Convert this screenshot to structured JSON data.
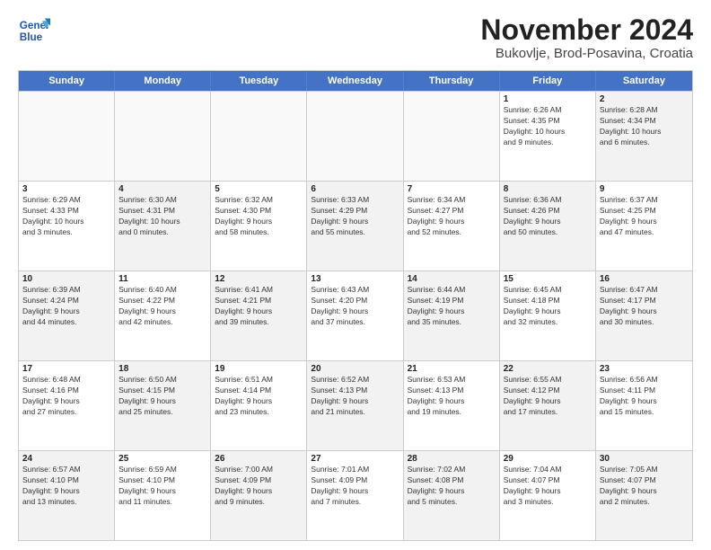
{
  "header": {
    "title": "November 2024",
    "subtitle": "Bukovlje, Brod-Posavina, Croatia",
    "logo_line1": "General",
    "logo_line2": "Blue"
  },
  "days_of_week": [
    "Sunday",
    "Monday",
    "Tuesday",
    "Wednesday",
    "Thursday",
    "Friday",
    "Saturday"
  ],
  "rows": [
    [
      {
        "day": "",
        "info": "",
        "empty": true
      },
      {
        "day": "",
        "info": "",
        "empty": true
      },
      {
        "day": "",
        "info": "",
        "empty": true
      },
      {
        "day": "",
        "info": "",
        "empty": true
      },
      {
        "day": "",
        "info": "",
        "empty": true
      },
      {
        "day": "1",
        "info": "Sunrise: 6:26 AM\nSunset: 4:35 PM\nDaylight: 10 hours\nand 9 minutes.",
        "empty": false
      },
      {
        "day": "2",
        "info": "Sunrise: 6:28 AM\nSunset: 4:34 PM\nDaylight: 10 hours\nand 6 minutes.",
        "empty": false,
        "shaded": true
      }
    ],
    [
      {
        "day": "3",
        "info": "Sunrise: 6:29 AM\nSunset: 4:33 PM\nDaylight: 10 hours\nand 3 minutes.",
        "empty": false
      },
      {
        "day": "4",
        "info": "Sunrise: 6:30 AM\nSunset: 4:31 PM\nDaylight: 10 hours\nand 0 minutes.",
        "empty": false,
        "shaded": true
      },
      {
        "day": "5",
        "info": "Sunrise: 6:32 AM\nSunset: 4:30 PM\nDaylight: 9 hours\nand 58 minutes.",
        "empty": false
      },
      {
        "day": "6",
        "info": "Sunrise: 6:33 AM\nSunset: 4:29 PM\nDaylight: 9 hours\nand 55 minutes.",
        "empty": false,
        "shaded": true
      },
      {
        "day": "7",
        "info": "Sunrise: 6:34 AM\nSunset: 4:27 PM\nDaylight: 9 hours\nand 52 minutes.",
        "empty": false
      },
      {
        "day": "8",
        "info": "Sunrise: 6:36 AM\nSunset: 4:26 PM\nDaylight: 9 hours\nand 50 minutes.",
        "empty": false,
        "shaded": true
      },
      {
        "day": "9",
        "info": "Sunrise: 6:37 AM\nSunset: 4:25 PM\nDaylight: 9 hours\nand 47 minutes.",
        "empty": false
      }
    ],
    [
      {
        "day": "10",
        "info": "Sunrise: 6:39 AM\nSunset: 4:24 PM\nDaylight: 9 hours\nand 44 minutes.",
        "empty": false,
        "shaded": true
      },
      {
        "day": "11",
        "info": "Sunrise: 6:40 AM\nSunset: 4:22 PM\nDaylight: 9 hours\nand 42 minutes.",
        "empty": false
      },
      {
        "day": "12",
        "info": "Sunrise: 6:41 AM\nSunset: 4:21 PM\nDaylight: 9 hours\nand 39 minutes.",
        "empty": false,
        "shaded": true
      },
      {
        "day": "13",
        "info": "Sunrise: 6:43 AM\nSunset: 4:20 PM\nDaylight: 9 hours\nand 37 minutes.",
        "empty": false
      },
      {
        "day": "14",
        "info": "Sunrise: 6:44 AM\nSunset: 4:19 PM\nDaylight: 9 hours\nand 35 minutes.",
        "empty": false,
        "shaded": true
      },
      {
        "day": "15",
        "info": "Sunrise: 6:45 AM\nSunset: 4:18 PM\nDaylight: 9 hours\nand 32 minutes.",
        "empty": false
      },
      {
        "day": "16",
        "info": "Sunrise: 6:47 AM\nSunset: 4:17 PM\nDaylight: 9 hours\nand 30 minutes.",
        "empty": false,
        "shaded": true
      }
    ],
    [
      {
        "day": "17",
        "info": "Sunrise: 6:48 AM\nSunset: 4:16 PM\nDaylight: 9 hours\nand 27 minutes.",
        "empty": false
      },
      {
        "day": "18",
        "info": "Sunrise: 6:50 AM\nSunset: 4:15 PM\nDaylight: 9 hours\nand 25 minutes.",
        "empty": false,
        "shaded": true
      },
      {
        "day": "19",
        "info": "Sunrise: 6:51 AM\nSunset: 4:14 PM\nDaylight: 9 hours\nand 23 minutes.",
        "empty": false
      },
      {
        "day": "20",
        "info": "Sunrise: 6:52 AM\nSunset: 4:13 PM\nDaylight: 9 hours\nand 21 minutes.",
        "empty": false,
        "shaded": true
      },
      {
        "day": "21",
        "info": "Sunrise: 6:53 AM\nSunset: 4:13 PM\nDaylight: 9 hours\nand 19 minutes.",
        "empty": false
      },
      {
        "day": "22",
        "info": "Sunrise: 6:55 AM\nSunset: 4:12 PM\nDaylight: 9 hours\nand 17 minutes.",
        "empty": false,
        "shaded": true
      },
      {
        "day": "23",
        "info": "Sunrise: 6:56 AM\nSunset: 4:11 PM\nDaylight: 9 hours\nand 15 minutes.",
        "empty": false
      }
    ],
    [
      {
        "day": "24",
        "info": "Sunrise: 6:57 AM\nSunset: 4:10 PM\nDaylight: 9 hours\nand 13 minutes.",
        "empty": false,
        "shaded": true
      },
      {
        "day": "25",
        "info": "Sunrise: 6:59 AM\nSunset: 4:10 PM\nDaylight: 9 hours\nand 11 minutes.",
        "empty": false
      },
      {
        "day": "26",
        "info": "Sunrise: 7:00 AM\nSunset: 4:09 PM\nDaylight: 9 hours\nand 9 minutes.",
        "empty": false,
        "shaded": true
      },
      {
        "day": "27",
        "info": "Sunrise: 7:01 AM\nSunset: 4:09 PM\nDaylight: 9 hours\nand 7 minutes.",
        "empty": false
      },
      {
        "day": "28",
        "info": "Sunrise: 7:02 AM\nSunset: 4:08 PM\nDaylight: 9 hours\nand 5 minutes.",
        "empty": false,
        "shaded": true
      },
      {
        "day": "29",
        "info": "Sunrise: 7:04 AM\nSunset: 4:07 PM\nDaylight: 9 hours\nand 3 minutes.",
        "empty": false
      },
      {
        "day": "30",
        "info": "Sunrise: 7:05 AM\nSunset: 4:07 PM\nDaylight: 9 hours\nand 2 minutes.",
        "empty": false,
        "shaded": true
      }
    ]
  ]
}
